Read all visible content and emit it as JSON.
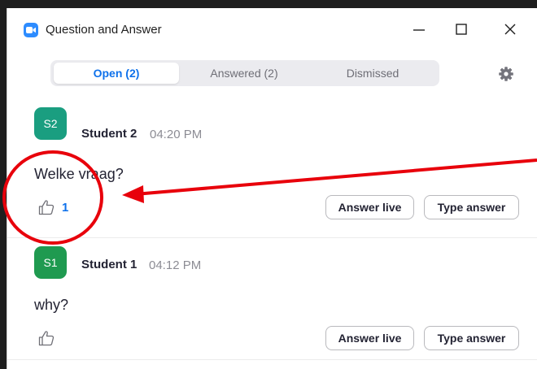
{
  "window": {
    "title": "Question and Answer"
  },
  "tabs": [
    {
      "label": "Open (2)",
      "active": true
    },
    {
      "label": "Answered (2)",
      "active": false
    },
    {
      "label": "Dismissed",
      "active": false
    }
  ],
  "questions": [
    {
      "avatar": "S2",
      "avatar_color": "#1a9e80",
      "name": "Student 2",
      "time": "04:20 PM",
      "text": "Welke vraag?",
      "likes": "1",
      "answer_live_label": "Answer live",
      "type_answer_label": "Type answer"
    },
    {
      "avatar": "S1",
      "avatar_color": "#1f9a50",
      "name": "Student 1",
      "time": "04:12 PM",
      "text": "why?",
      "likes": "",
      "answer_live_label": "Answer live",
      "type_answer_label": "Type answer"
    }
  ],
  "colors": {
    "accent": "#0e71eb",
    "annotation": "#e8000b",
    "app_icon": "#2d8cff"
  },
  "icons": [
    "zoom-app-icon",
    "minimize-icon",
    "maximize-icon",
    "close-icon",
    "gear-icon",
    "thumbs-up-icon"
  ]
}
